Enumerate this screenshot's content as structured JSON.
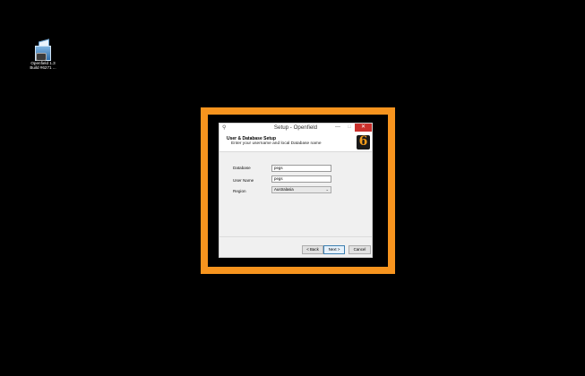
{
  "desktop": {
    "icon": {
      "name": "installer-icon",
      "label_line1": "Openfield 1.3",
      "label_line2": "Build #6271 ..."
    }
  },
  "colors": {
    "highlight": "#f7941e",
    "close_button": "#c9302c",
    "logo_accent": "#f39c1b"
  },
  "dialog": {
    "title": "Setup - Openfield",
    "window_buttons": {
      "minimize": "—",
      "maximize": "□",
      "close": "✕"
    },
    "header": {
      "title": "User & Database Setup",
      "subtitle": "Enter your username and local Database name",
      "logo_glyph": "6"
    },
    "form": {
      "database": {
        "label": "Database",
        "value": "pegs"
      },
      "username": {
        "label": "User Name",
        "value": "pegs"
      },
      "region": {
        "label": "Region",
        "value": "Australasia"
      }
    },
    "buttons": {
      "back": "< Back",
      "next": "Next >",
      "cancel": "Cancel"
    }
  }
}
